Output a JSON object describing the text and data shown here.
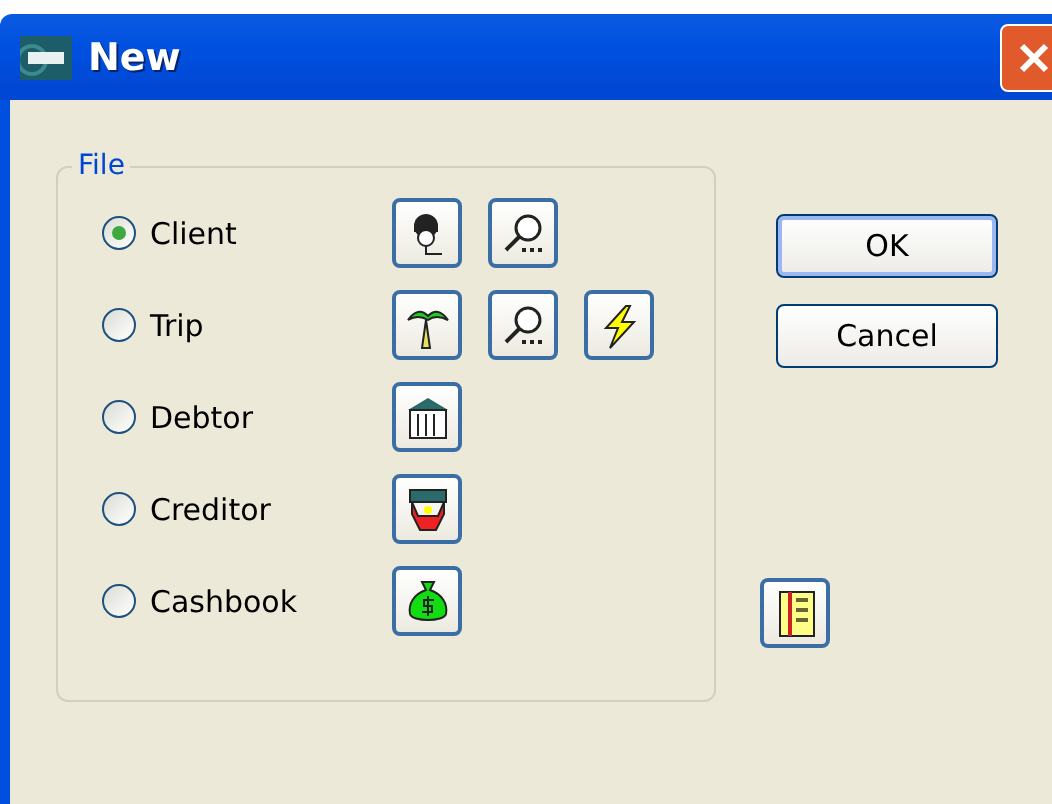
{
  "window": {
    "title": "New"
  },
  "group": {
    "label": "File"
  },
  "options": [
    {
      "label": "Client",
      "selected": true,
      "icons": [
        {
          "kind": "person"
        },
        {
          "kind": "search"
        }
      ]
    },
    {
      "label": "Trip",
      "selected": false,
      "icons": [
        {
          "kind": "palm"
        },
        {
          "kind": "search"
        },
        {
          "kind": "lightning"
        }
      ]
    },
    {
      "label": "Debtor",
      "selected": false,
      "icons": [
        {
          "kind": "building"
        }
      ]
    },
    {
      "label": "Creditor",
      "selected": false,
      "icons": [
        {
          "kind": "creditor"
        }
      ]
    },
    {
      "label": "Cashbook",
      "selected": false,
      "icons": [
        {
          "kind": "moneybag"
        }
      ]
    }
  ],
  "extra_button": {
    "kind": "ledger"
  },
  "buttons": [
    {
      "label": "OK",
      "default": true
    },
    {
      "label": "Cancel",
      "default": false
    }
  ]
}
